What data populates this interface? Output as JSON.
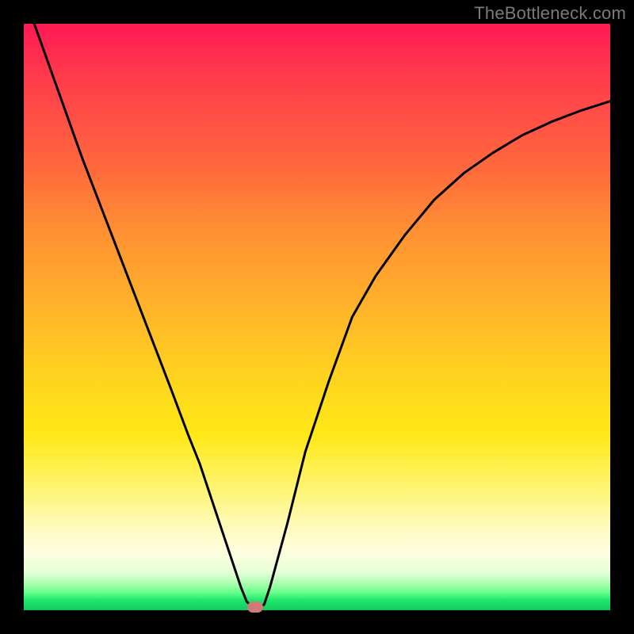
{
  "watermark": "TheBottleneck.com",
  "colors": {
    "frame": "#000000",
    "gradient_top": "#ff1a55",
    "gradient_bottom": "#13c95f",
    "curve": "#000000",
    "marker": "#cf7a77"
  },
  "chart_data": {
    "type": "line",
    "title": "",
    "xlabel": "",
    "ylabel": "",
    "xlim": [
      0,
      100
    ],
    "ylim": [
      0,
      100
    ],
    "series": [
      {
        "name": "bottleneck-curve",
        "x": [
          0,
          5,
          10,
          15,
          20,
          25,
          28,
          30,
          32,
          34,
          36,
          37,
          38,
          39,
          40,
          41,
          42,
          45,
          48,
          52,
          56,
          60,
          65,
          70,
          75,
          80,
          85,
          90,
          95,
          100
        ],
        "values": [
          105,
          91,
          77,
          64,
          51,
          38,
          30,
          25,
          19,
          13,
          7,
          4,
          1.5,
          0.5,
          0.3,
          1.0,
          4,
          15,
          27,
          39,
          50,
          57,
          64,
          70,
          74.5,
          78,
          81,
          83.3,
          85.2,
          86.8
        ]
      }
    ],
    "marker": {
      "x": 39.5,
      "y": 0.6
    },
    "annotations": []
  }
}
